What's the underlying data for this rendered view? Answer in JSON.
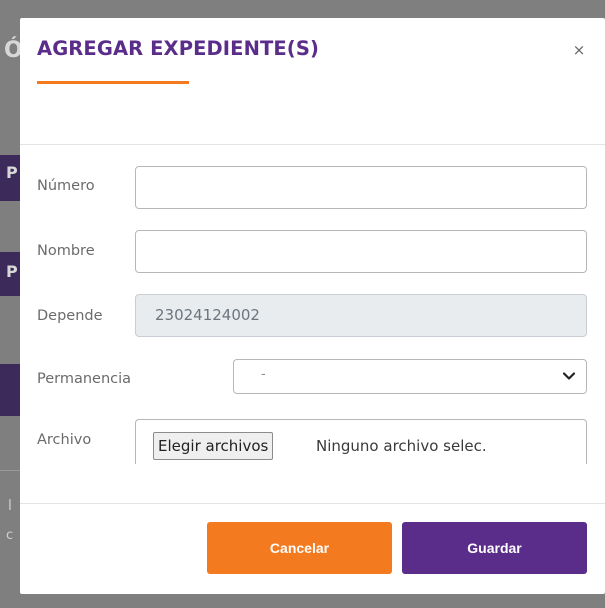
{
  "modal": {
    "title": "AGREGAR EXPEDIENTE(S)",
    "close_label": "×"
  },
  "fields": {
    "numero": {
      "label": "Número",
      "value": ""
    },
    "nombre": {
      "label": "Nombre",
      "value": ""
    },
    "depende": {
      "label": "Depende",
      "value": "23024124002"
    },
    "permanencia": {
      "label": "Permanencia",
      "selected": "-"
    },
    "archivo": {
      "label": "Archivo",
      "button_label": "Elegir archivos",
      "status": "Ninguno archivo selec."
    }
  },
  "buttons": {
    "cancel_label": "Cancelar",
    "save_label": "Guardar"
  },
  "background": {
    "fragment_chars": [
      "Ó",
      "P",
      "P",
      "l",
      "c"
    ]
  },
  "colors": {
    "brand_purple": "#5b2d8a",
    "brand_orange": "#f47a20",
    "overlay": "#7f7f7f"
  }
}
